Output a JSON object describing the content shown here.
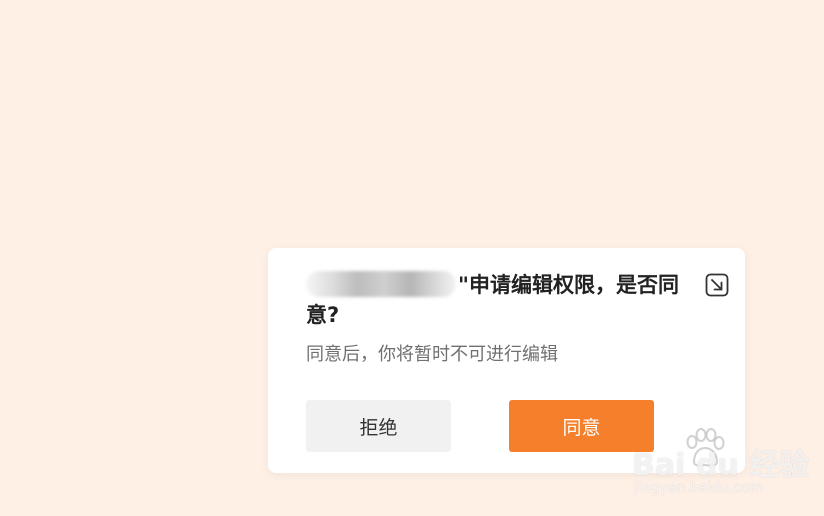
{
  "dialog": {
    "title": "\"申请编辑权限，是否同意?",
    "description": "同意后，你将暂时不可进行编辑",
    "reject_label": "拒绝",
    "accept_label": "同意",
    "collapse_icon": "collapse-arrow-icon"
  },
  "watermark": {
    "brand": "Bai du 经验",
    "url": "jingyan.baidu.com"
  },
  "colors": {
    "background": "#fff0e6",
    "accent": "#f57f2a",
    "reject_bg": "#f1f1f1"
  }
}
